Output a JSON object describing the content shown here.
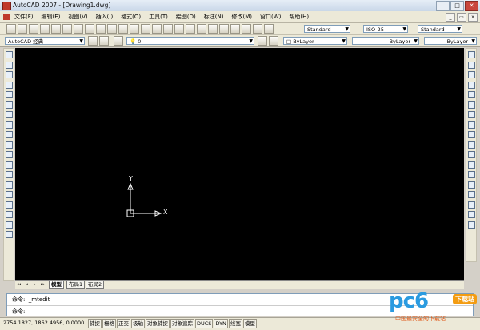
{
  "window": {
    "title": "AutoCAD 2007 - [Drawing1.dwg]"
  },
  "menubar": {
    "items": [
      "文件(F)",
      "编辑(E)",
      "视图(V)",
      "插入(I)",
      "格式(O)",
      "工具(T)",
      "绘图(D)",
      "标注(N)",
      "修改(M)",
      "窗口(W)",
      "帮助(H)"
    ]
  },
  "toolbar": {
    "text_style": "Standard",
    "dim_style": "ISO-25",
    "table_style": "Standard",
    "workspace": "AutoCAD 经典",
    "layer": "0",
    "color": "ByLayer",
    "linetype": "ByLayer",
    "lineweight": "ByLayer"
  },
  "canvas": {
    "ucs_x_label": "X",
    "ucs_y_label": "Y",
    "background": "#000000"
  },
  "layout_tabs": {
    "nav": [
      "◂◂",
      "◂",
      "▸",
      "▸▸"
    ],
    "tabs": [
      "模型",
      "布局1",
      "布局2"
    ]
  },
  "command_window": {
    "line1": "命令:  _mtedit",
    "line2": "命令:"
  },
  "statusbar": {
    "coords": "2754.1827, 1862.4956, 0.0000",
    "buttons": [
      "捕捉",
      "栅格",
      "正交",
      "极轴",
      "对象捕捉",
      "对象追踪",
      "DUCS",
      "DYN",
      "线宽",
      "模型"
    ]
  },
  "watermark": {
    "logo": "pc6",
    "badge": "下载站",
    "subtitle": "中国最安全的下载站"
  }
}
